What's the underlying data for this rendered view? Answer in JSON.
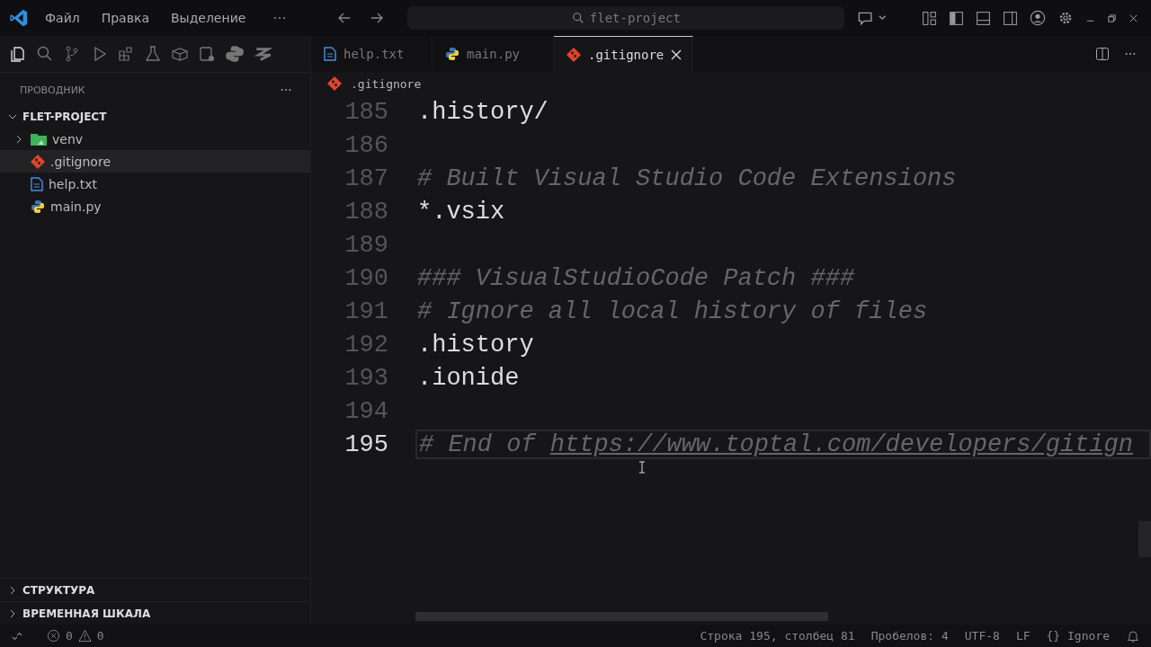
{
  "menu": [
    "Файл",
    "Правка",
    "Выделение"
  ],
  "command_center": {
    "value": "flet-project"
  },
  "sidebar": {
    "title": "ПРОВОДНИК",
    "tree": [
      {
        "label": "FLET-PROJECT",
        "expanded": true,
        "children": [
          {
            "label": "venv",
            "kind": "folder",
            "expanded": false,
            "selected": false
          },
          {
            "label": ".gitignore",
            "kind": "git",
            "selected": true
          },
          {
            "label": "help.txt",
            "kind": "text",
            "selected": false
          },
          {
            "label": "main.py",
            "kind": "python",
            "selected": false
          }
        ]
      }
    ],
    "sections": [
      {
        "label": "СТРУКТУРА",
        "expanded": false
      },
      {
        "label": "ВРЕМЕННАЯ ШКАЛА",
        "expanded": false
      }
    ]
  },
  "tabs": [
    {
      "label": "help.txt",
      "kind": "text",
      "selected": false
    },
    {
      "label": "main.py",
      "kind": "python",
      "selected": false
    },
    {
      "label": ".gitignore",
      "kind": "git",
      "selected": true
    }
  ],
  "breadcrumb": {
    "label": ".gitignore",
    "kind": "git"
  },
  "lines": [
    {
      "num": "185",
      "kind": "code",
      "text": ".history/",
      "current": false
    },
    {
      "num": "186",
      "kind": "blank",
      "current": false
    },
    {
      "num": "187",
      "kind": "comment",
      "text": "# Built Visual Studio Code Extensions",
      "current": false
    },
    {
      "num": "188",
      "kind": "code",
      "text": "*.vsix",
      "current": false
    },
    {
      "num": "189",
      "kind": "blank",
      "current": false
    },
    {
      "num": "190",
      "kind": "comment",
      "text": "### VisualStudioCode Patch ###",
      "current": false
    },
    {
      "num": "191",
      "kind": "comment",
      "text": "# Ignore all local history of files",
      "current": false
    },
    {
      "num": "192",
      "kind": "code",
      "text": ".history",
      "current": false
    },
    {
      "num": "193",
      "kind": "code",
      "text": ".ionide",
      "current": false
    },
    {
      "num": "194",
      "kind": "blank",
      "current": false
    },
    {
      "num": "195",
      "kind": "comment",
      "text": "# End of ",
      "link": "https://www.toptal.com/developers/gitign",
      "current": true
    }
  ],
  "status_bar": {
    "errors": "0",
    "warnings": "0",
    "items": [
      "Строка 195, столбец 81",
      "Пробелов: 4",
      "UTF-8",
      "LF",
      "{} Ignore"
    ]
  }
}
